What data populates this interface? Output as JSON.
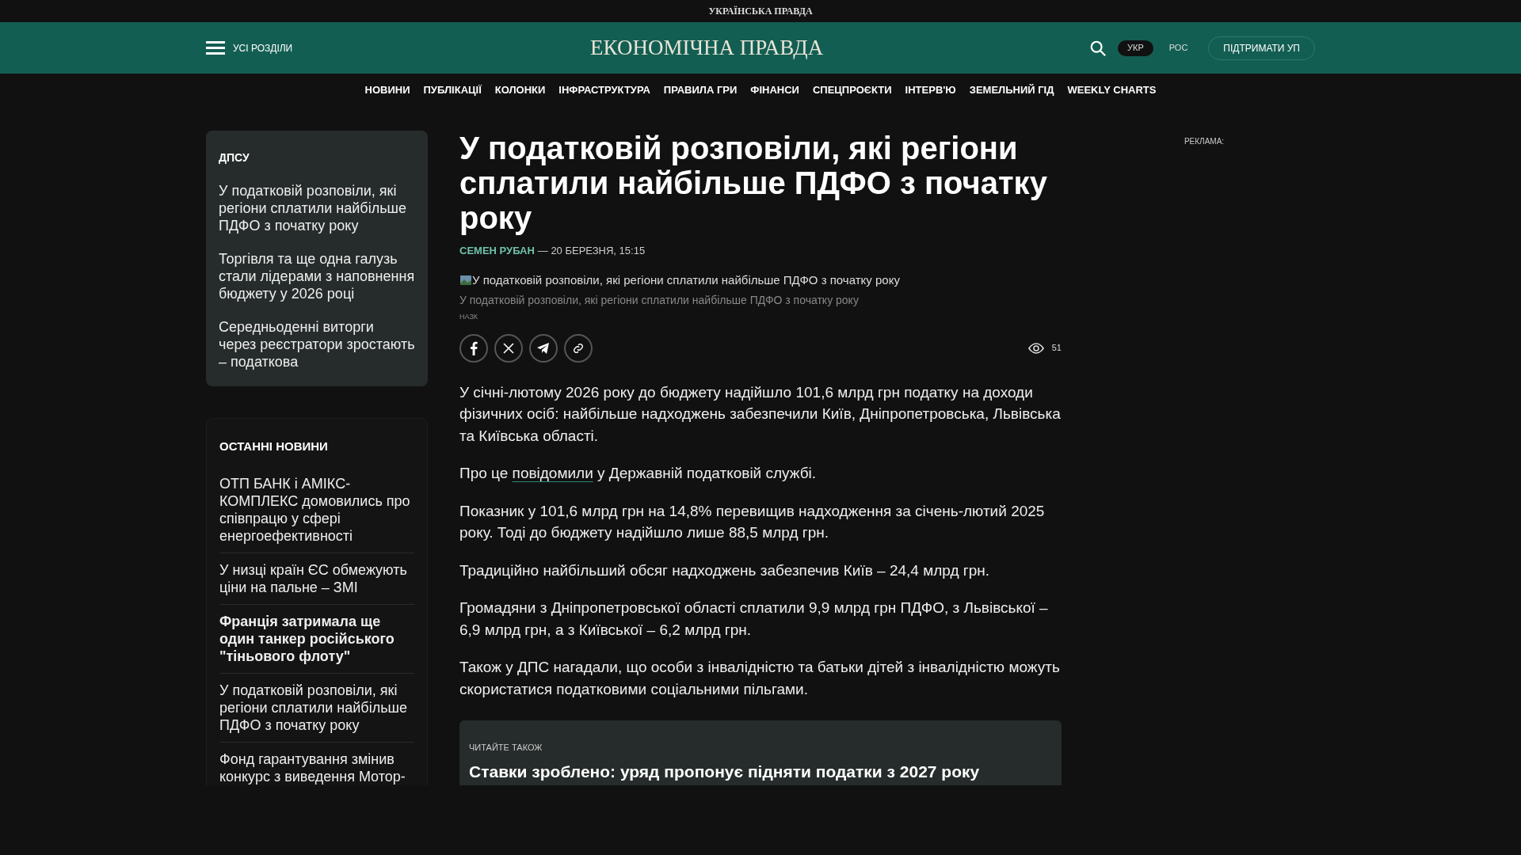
{
  "top_strip": {
    "title": "УКРАЇНСЬКА ПРАВДА"
  },
  "header": {
    "menu_label": "УСІ РОЗДІЛИ",
    "logo": "ЕКОНОМІЧНА ПРАВДА",
    "languages": [
      {
        "label": "УКР",
        "selected": true
      },
      {
        "label": "РОС",
        "selected": false
      }
    ],
    "support_button": "ПІДТРИМАТИ УП"
  },
  "nav": [
    "НОВИНИ",
    "ПУБЛІКАЦІЇ",
    "КОЛОНКИ",
    "ІНФРАСТРУКТУРА",
    "ПРАВИЛА ГРИ",
    "ФІНАНСИ",
    "СПЕЦПРОЄКТИ",
    "ІНТЕРВ'Ю",
    "ЗЕМЕЛЬНИЙ ГІД",
    "WEEKLY CHARTS"
  ],
  "sidebar": {
    "tag_box": {
      "title": "ДПСУ",
      "items": [
        "У податковій розповіли, які регіони сплатили найбільше ПДФО з початку року",
        "Торгівля та ще одна галузь стали лідерами з наповнення бюджету у 2026 році",
        "Середньоденні виторги через реєстратори зростають – податкова"
      ]
    },
    "latest": {
      "title": "ОСТАННІ НОВИНИ",
      "items": [
        {
          "text": "ОТП БАНК і АМІКС-КОМПЛЕКС домовились про співпрацю у сфері енергоефективності",
          "bold": false
        },
        {
          "text": "У низці країн ЄС обмежують ціни на пальне – ЗМІ",
          "bold": false
        },
        {
          "text": "Франція затримала ще один танкер російського \"тіньового флоту\"",
          "bold": true
        },
        {
          "text": "У податковій розповіли, які регіони сплатили найбільше ПДФО з початку року",
          "bold": false
        },
        {
          "text": "Фонд гарантування змінив конкурс з виведення Мотор-",
          "bold": false
        }
      ]
    }
  },
  "article": {
    "title": "У податковій розповіли, які регіони сплатили найбільше ПДФО з початку року",
    "author": "СЕМЕН РУБАН",
    "date": "— 20 БЕРЕЗНЯ, 15:15",
    "image_alt": "У податковій розповіли, які регіони сплатили найбільше ПДФО з початку року",
    "caption": "У податковій розповіли, які регіони сплатили найбільше ПДФО з початку року",
    "credit": "НАЗК",
    "views": "51",
    "paragraphs": [
      [
        {
          "text": "У січні-лютому 2026 року до бюджету надійшло 101,6 млрд грн податку на доходи фізичних осіб: найбільше надходжень забезпечили Київ, Дніпропетровська, Львівська та Київська області.",
          "link": false
        }
      ],
      [
        {
          "text": "Про це ",
          "link": false
        },
        {
          "text": "повідомили",
          "link": true
        },
        {
          "text": " у Державній податковій службі.",
          "link": false
        }
      ],
      [
        {
          "text": "Показник у 101,6 млрд грн на 14,8% перевищив надходження за січень-лютий 2025 року. Тоді до бюджету надійшло лише 88,5 млрд грн.",
          "link": false
        }
      ],
      [
        {
          "text": "Традиційно найбільший обсяг надходжень забезпечив Київ – 24,4 млрд грн.",
          "link": false
        }
      ],
      [
        {
          "text": "Громадяни з Дніпропетровської області сплатили 9,9 млрд грн ПДФО, з Львівської – 6,9 млрд грн, а з Київської – 6,2 млрд грн.",
          "link": false
        }
      ],
      [
        {
          "text": "Також у ДПС нагадали, що особи з інвалідністю та батьки дітей з інвалідністю можуть скористатися податковими соціальними пільгами.",
          "link": false
        }
      ]
    ],
    "read_also": {
      "label": "ЧИТАЙТЕ ТАКОЖ",
      "title": "Ставки зроблено: уряд пропонує підняти податки з 2027 року"
    }
  },
  "ad_label": "РЕКЛАМА:"
}
